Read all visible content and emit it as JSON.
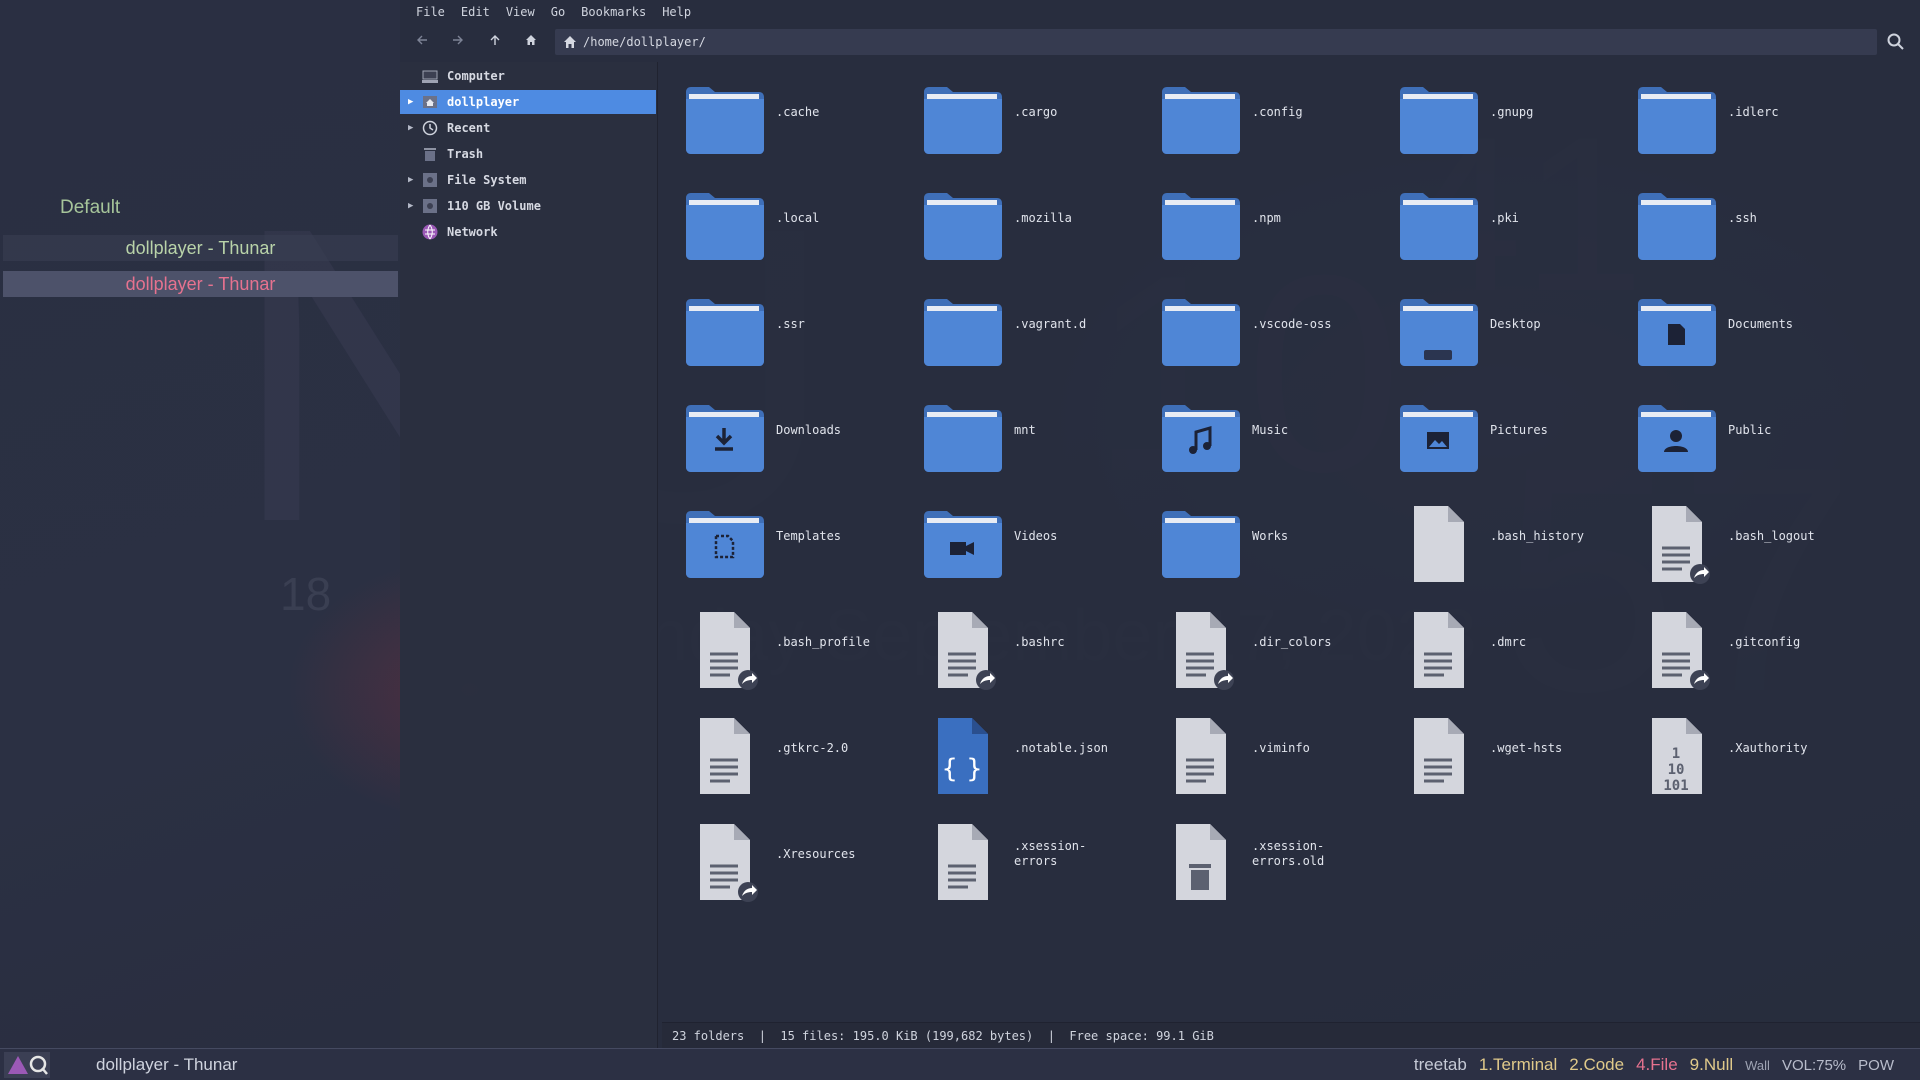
{
  "left_panel": {
    "group_title": "Default",
    "windows": [
      "dollplayer - Thunar",
      "dollplayer - Thunar"
    ]
  },
  "menubar": [
    "File",
    "Edit",
    "View",
    "Go",
    "Bookmarks",
    "Help"
  ],
  "toolbar": {
    "back_icon": "arrow-left-icon",
    "forward_icon": "arrow-right-icon",
    "up_icon": "arrow-up-icon",
    "home_icon": "home-icon",
    "location": "/home/dollplayer/",
    "search_icon": "search-icon"
  },
  "sidebar": [
    {
      "label": "Computer",
      "icon": "computer-icon",
      "expandable": false,
      "selected": false
    },
    {
      "label": "dollplayer",
      "icon": "home-drive-icon",
      "expandable": true,
      "selected": true
    },
    {
      "label": "Recent",
      "icon": "clock-icon",
      "expandable": true,
      "selected": false
    },
    {
      "label": "Trash",
      "icon": "trash-icon",
      "expandable": false,
      "selected": false
    },
    {
      "label": "File System",
      "icon": "drive-icon",
      "expandable": true,
      "selected": false
    },
    {
      "label": "110 GB Volume",
      "icon": "drive-icon",
      "expandable": true,
      "selected": false
    },
    {
      "label": "Network",
      "icon": "network-icon",
      "expandable": false,
      "selected": false
    }
  ],
  "files": [
    {
      "name": ".cache",
      "type": "folder"
    },
    {
      "name": ".cargo",
      "type": "folder"
    },
    {
      "name": ".config",
      "type": "folder"
    },
    {
      "name": ".gnupg",
      "type": "folder"
    },
    {
      "name": ".idlerc",
      "type": "folder"
    },
    {
      "name": ".local",
      "type": "folder"
    },
    {
      "name": ".mozilla",
      "type": "folder"
    },
    {
      "name": ".npm",
      "type": "folder"
    },
    {
      "name": ".pki",
      "type": "folder"
    },
    {
      "name": ".ssh",
      "type": "folder"
    },
    {
      "name": ".ssr",
      "type": "folder"
    },
    {
      "name": ".vagrant.d",
      "type": "folder"
    },
    {
      "name": ".vscode-oss",
      "type": "folder"
    },
    {
      "name": "Desktop",
      "type": "folder",
      "emblem": "desktop"
    },
    {
      "name": "Documents",
      "type": "folder",
      "emblem": "document"
    },
    {
      "name": "Downloads",
      "type": "folder",
      "emblem": "download"
    },
    {
      "name": "mnt",
      "type": "folder"
    },
    {
      "name": "Music",
      "type": "folder",
      "emblem": "music"
    },
    {
      "name": "Pictures",
      "type": "folder",
      "emblem": "picture"
    },
    {
      "name": "Public",
      "type": "folder",
      "emblem": "person"
    },
    {
      "name": "Templates",
      "type": "folder",
      "emblem": "template"
    },
    {
      "name": "Videos",
      "type": "folder",
      "emblem": "video"
    },
    {
      "name": "Works",
      "type": "folder"
    },
    {
      "name": ".bash_history",
      "type": "blank"
    },
    {
      "name": ".bash_logout",
      "type": "text",
      "link": true
    },
    {
      "name": ".bash_profile",
      "type": "text",
      "link": true
    },
    {
      "name": ".bashrc",
      "type": "text",
      "link": true
    },
    {
      "name": ".dir_colors",
      "type": "text",
      "link": true
    },
    {
      "name": ".dmrc",
      "type": "text"
    },
    {
      "name": ".gitconfig",
      "type": "text",
      "link": true
    },
    {
      "name": ".gtkrc-2.0",
      "type": "text"
    },
    {
      "name": ".notable.json",
      "type": "json"
    },
    {
      "name": ".viminfo",
      "type": "text"
    },
    {
      "name": ".wget-hsts",
      "type": "text"
    },
    {
      "name": ".Xauthority",
      "type": "binary"
    },
    {
      "name": ".Xresources",
      "type": "text",
      "link": true
    },
    {
      "name": ".xsession-errors",
      "type": "text"
    },
    {
      "name": ".xsession-errors.old",
      "type": "trash"
    }
  ],
  "statusbar": {
    "folders": "23 folders",
    "files": "15 files: 195.0 KiB (199,682 bytes)",
    "free": "Free space: 99.1 GiB"
  },
  "taskbar": {
    "title": "dollplayer - Thunar",
    "layout": "treetab",
    "workspaces": [
      "1.Terminal",
      "2.Code",
      "4.File",
      "9.Null"
    ],
    "wall": "Wall",
    "vol": "VOL:75%",
    "pow": "POW"
  },
  "colors": {
    "folder": "#4f86d6",
    "selected": "#4e8be2",
    "group_title": "#a6c59a",
    "active_window": "#e6728f"
  }
}
